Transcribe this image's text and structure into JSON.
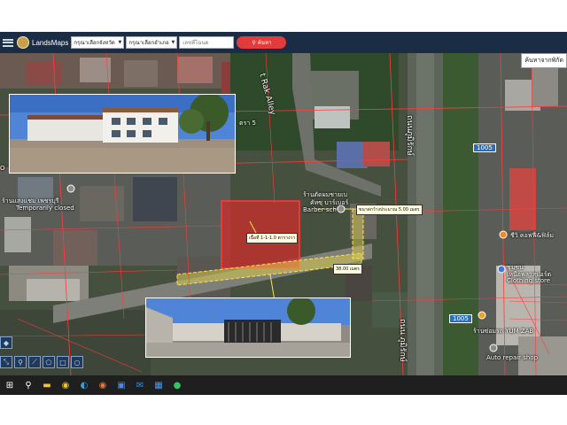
{
  "header": {
    "brand": "LandsMaps",
    "province_select": "กรุณาเลือกจังหวัด",
    "district_select": "กรุณาเลือกอำเภอ",
    "parcel_placeholder": "เลขที่โฉนด",
    "search_label": "ค้นหา"
  },
  "map": {
    "search_corner_label": "ค้นหาจากพิกัด",
    "road_labels": {
      "alley": "t Rak Alley",
      "main_road_1": "ถนนภูมิรักษ์",
      "main_road_2": "ถนน ภูมิรักษ์",
      "soi": "ตรา 5"
    },
    "route_badges": [
      "1005",
      "1005"
    ],
    "places": {
      "shop_left": "ร้านแสงแช่ม เพชรบุรี",
      "shop_left_status": "Temporarily closed",
      "barber_name": "ร้านตัดผมชายเบ",
      "barber_name2": "คัทซุ บาร์เบอร์",
      "barber_en": "Barber sch",
      "coffee": "ชีวิ คอฟฟี่&ฟิล์ม",
      "clothing_th": "ชุมชน",
      "clothing_th2": "เหนือพลาสปอร์ต",
      "clothing_en": "Clothing store",
      "repair_th": "ร้านซ่อมรถ YUM ZAB",
      "repair_en": "Auto repair shop"
    },
    "callouts": {
      "area": "เนื้อที่ 1-1-1.0 ตารางวา",
      "width": "ขนาดกว้างประมาณ 5.00 เมตร",
      "length": "38.00 เมตร"
    },
    "left_edge_letter": "O"
  },
  "colors": {
    "header_bg": "#1b2d44",
    "search_button": "#e23b3b",
    "parcel_fill": "#d62a2a",
    "route_badge": "#2f6db5",
    "taskbar": "#1f1f1f"
  },
  "icons": {
    "menu": "hamburger-icon",
    "logo": "landsmaps-logo",
    "search": "search-icon",
    "tools": [
      "layers-icon",
      "satellite-icon"
    ],
    "draw_tools": [
      "ruler-icon",
      "marker-icon",
      "polyline-icon",
      "polygon-icon",
      "rectangle-icon",
      "circle-icon"
    ],
    "taskbar": [
      "windows-start-icon",
      "search-icon",
      "file-explorer-icon",
      "chrome-icon",
      "edge-icon",
      "chrome-icon",
      "store-icon",
      "mail-icon",
      "photos-icon",
      "line-icon"
    ]
  }
}
